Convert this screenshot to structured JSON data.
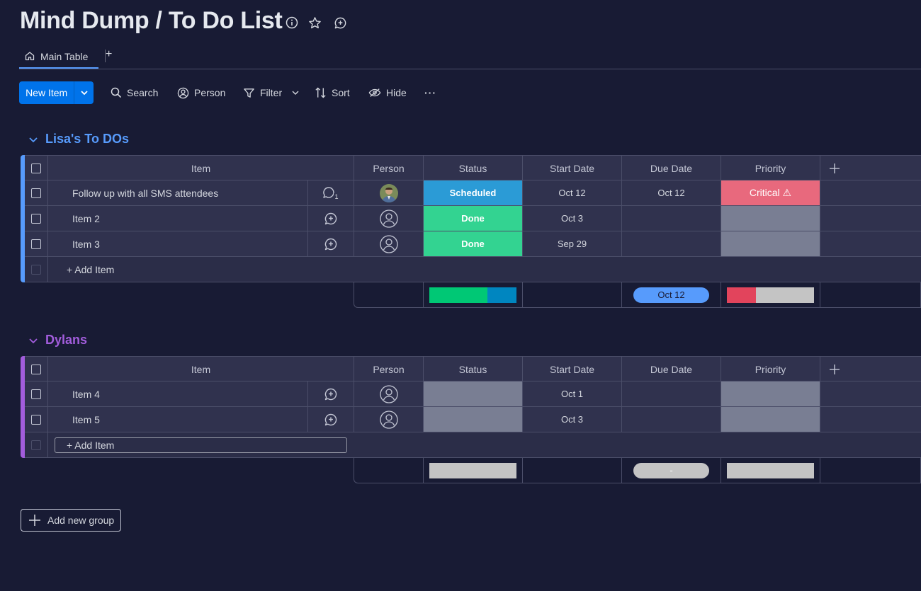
{
  "board": {
    "title": "Mind Dump / To Do List",
    "tabs": [
      {
        "label": "Main Table"
      }
    ],
    "tab_add_label": "+"
  },
  "toolbar": {
    "new_item_label": "New Item",
    "search_label": "Search",
    "person_label": "Person",
    "filter_label": "Filter",
    "sort_label": "Sort",
    "hide_label": "Hide",
    "more_label": "···"
  },
  "columns": [
    "Item",
    "Person",
    "Status",
    "Start Date",
    "Due Date",
    "Priority"
  ],
  "colors": {
    "background": "#181b34",
    "primary": "#0073ea",
    "group1": "#579bfc",
    "group2": "#a25ddc",
    "scheduled": "#2b9bd6",
    "done": "#33d391",
    "critical": "#e8697d",
    "empty_cell": "#797e93",
    "summary_green": "#00c875",
    "summary_blue": "#0086c0",
    "summary_red": "#e2445c",
    "summary_gray": "#c4c4c4",
    "date_pill": "#579bfc"
  },
  "groups": [
    {
      "name": "Lisa's To DOs",
      "rows": [
        {
          "item": "Follow up with all SMS attendees",
          "updates": "1",
          "person": "photo",
          "status": "Scheduled",
          "start": "Oct 12",
          "due": "Oct 12",
          "priority": "Critical ⚠"
        },
        {
          "item": "Item 2",
          "updates": "",
          "person": "empty",
          "status": "Done",
          "start": "Oct 3",
          "due": "",
          "priority": ""
        },
        {
          "item": "Item 3",
          "updates": "",
          "person": "empty",
          "status": "Done",
          "start": "Sep 29",
          "due": "",
          "priority": ""
        }
      ],
      "add_item_label": "+ Add Item",
      "summary": {
        "due": "Oct 12",
        "status_done_fraction": 0.67,
        "status_scheduled_fraction": 0.33,
        "priority_critical_fraction": 0.33
      }
    },
    {
      "name": "Dylans",
      "rows": [
        {
          "item": "Item 4",
          "updates": "",
          "person": "empty",
          "status": "",
          "start": "Oct 1",
          "due": "",
          "priority": ""
        },
        {
          "item": "Item 5",
          "updates": "",
          "person": "empty",
          "status": "",
          "start": "Oct 3",
          "due": "",
          "priority": ""
        }
      ],
      "add_item_label": "+ Add Item",
      "summary": {
        "due": "-"
      }
    }
  ],
  "add_group_label": "Add new group"
}
